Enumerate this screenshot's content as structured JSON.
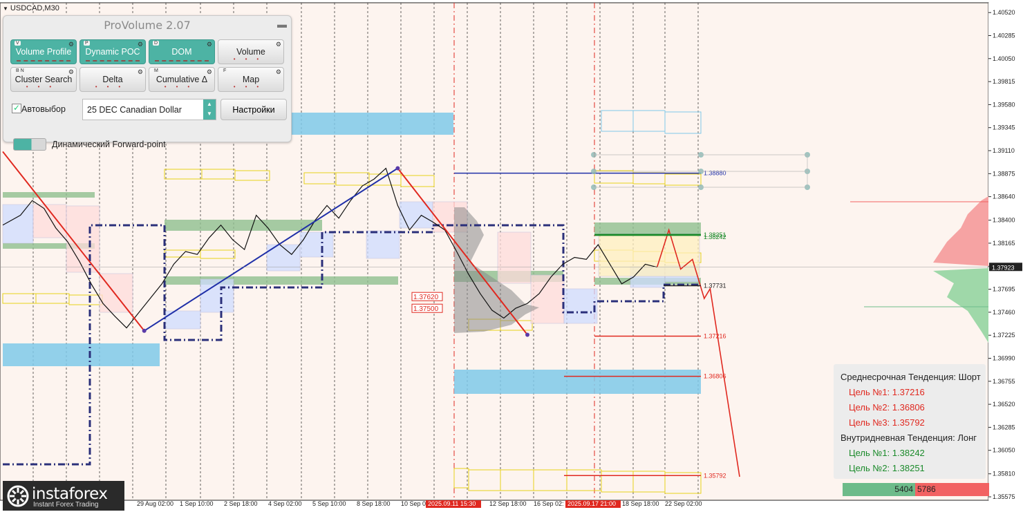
{
  "symbol": "USDCAD,M30",
  "panel": {
    "title": "ProVolume 2.07",
    "buttons": [
      {
        "key": "V",
        "label": "Volume Profile",
        "active": true
      },
      {
        "key": "P",
        "label": "Dynamic POC",
        "active": true
      },
      {
        "key": "D",
        "label": "DOM",
        "active": true
      },
      {
        "key": "",
        "label": "Volume",
        "active": false
      },
      {
        "key": "B N",
        "label": "Cluster Search",
        "active": false
      },
      {
        "key": "",
        "label": "Delta",
        "active": false
      },
      {
        "key": "M",
        "label": "Cumulative Δ",
        "active": false
      },
      {
        "key": "F",
        "label": "Map",
        "active": false
      }
    ],
    "auto_label": "Автовыбор",
    "instrument": "25 DEC Canadian Dollar",
    "settings_label": "Настройки",
    "forward_label": "Динамический Forward-point"
  },
  "trend": {
    "medium_title": "Среднесрочная Тенденция: Шорт",
    "medium_targets": [
      "Цель №1: 1.37216",
      "Цель №2: 1.36806",
      "Цель №3: 1.35792"
    ],
    "intraday_title": "Внутридневная Тенденция: Лонг",
    "intraday_targets": [
      "Цель №1: 1.38242",
      "Цель №2: 1.38251"
    ]
  },
  "volume_bar": {
    "buy": "5404",
    "sell": "5786",
    "buy_color": "#6dbb8a",
    "sell_color": "#f26262"
  },
  "logo": {
    "brand": "instaforex",
    "tagline": "Instant Forex Trading"
  },
  "colors": {
    "bg": "#fdf4ef",
    "up_line": "#1f2fa8",
    "down_line": "#e0281f",
    "grey_zone": "#7fc9e9",
    "hvn": "#8fbf8f"
  },
  "chart_data": {
    "type": "line",
    "title": "USDCAD,M30",
    "y_ticks": [
      "1.40520",
      "1.40285",
      "1.40050",
      "1.39815",
      "1.39580",
      "1.39345",
      "1.39110",
      "1.38875",
      "1.38640",
      "1.38400",
      "1.38165",
      "1.37930",
      "1.37695",
      "1.37460",
      "1.37225",
      "1.36990",
      "1.36755",
      "1.36520",
      "1.36285",
      "1.36050",
      "1.35810",
      "1.35575"
    ],
    "ylim": [
      1.3554,
      1.4062
    ],
    "x_ticks": [
      "29 Aug 02:00",
      "1 Sep 10:00",
      "2 Sep 18:00",
      "4 Sep 02:00",
      "5 Sep 10:00",
      "8 Sep 18:00",
      "10 Sep 0",
      "12 Sep 18:00",
      "16 Sep 02:",
      "18 Sep 18:00",
      "22 Sep 02:00"
    ],
    "x_highlights": [
      "2025.09.11 15:30",
      "2025.09.17 21:00"
    ],
    "current_price": "1.37923",
    "level_labels": [
      {
        "text": "1.38880",
        "price": 1.3888,
        "color": "#1f2fa8"
      },
      {
        "text": "1.38251",
        "price": 1.3825,
        "color": "#1a8a2a"
      },
      {
        "text": "1.38242",
        "price": 1.38242,
        "color": "#1a8a2a"
      },
      {
        "text": "1.37731",
        "price": 1.37731,
        "color": "#222222"
      },
      {
        "text": "1.37216",
        "price": 1.37216,
        "color": "#e0281f"
      },
      {
        "text": "1.36806",
        "price": 1.36806,
        "color": "#e0281f"
      },
      {
        "text": "1.35792",
        "price": 1.35792,
        "color": "#e0281f"
      }
    ],
    "boxed_labels": [
      {
        "text": "1.37620",
        "price": 1.3762
      },
      {
        "text": "1.37500",
        "price": 1.375
      }
    ],
    "price_path": [
      [
        0,
        1.3835
      ],
      [
        6,
        1.3845
      ],
      [
        10,
        1.386
      ],
      [
        14,
        1.3852
      ],
      [
        18,
        1.3832
      ],
      [
        22,
        1.3818
      ],
      [
        26,
        1.3798
      ],
      [
        30,
        1.3775
      ],
      [
        34,
        1.3755
      ],
      [
        38,
        1.3742
      ],
      [
        42,
        1.373
      ],
      [
        46,
        1.3745
      ],
      [
        50,
        1.376
      ],
      [
        54,
        1.3775
      ],
      [
        58,
        1.3795
      ],
      [
        62,
        1.3808
      ],
      [
        66,
        1.3805
      ],
      [
        70,
        1.3822
      ],
      [
        74,
        1.3835
      ],
      [
        78,
        1.382
      ],
      [
        82,
        1.381
      ],
      [
        86,
        1.3845
      ],
      [
        90,
        1.3832
      ],
      [
        94,
        1.3815
      ],
      [
        98,
        1.3805
      ],
      [
        102,
        1.382
      ],
      [
        106,
        1.384
      ],
      [
        110,
        1.3855
      ],
      [
        114,
        1.3842
      ],
      [
        118,
        1.386
      ],
      [
        122,
        1.3875
      ],
      [
        126,
        1.3882
      ],
      [
        130,
        1.3893
      ],
      [
        134,
        1.3855
      ],
      [
        138,
        1.383
      ],
      [
        142,
        1.3845
      ],
      [
        146,
        1.3838
      ],
      [
        150,
        1.383
      ],
      [
        154,
        1.3808
      ],
      [
        158,
        1.3785
      ],
      [
        162,
        1.3765
      ],
      [
        166,
        1.3748
      ],
      [
        170,
        1.374
      ],
      [
        174,
        1.375
      ],
      [
        178,
        1.3755
      ],
      [
        182,
        1.3765
      ],
      [
        186,
        1.3782
      ],
      [
        190,
        1.3795
      ],
      [
        194,
        1.3802
      ],
      [
        198,
        1.38
      ],
      [
        202,
        1.3815
      ],
      [
        206,
        1.3795
      ],
      [
        210,
        1.3775
      ],
      [
        214,
        1.3782
      ],
      [
        218,
        1.3795
      ],
      [
        222,
        1.3792
      ]
    ],
    "forecast_path": [
      [
        222,
        1.3792
      ],
      [
        226,
        1.383
      ],
      [
        230,
        1.379
      ],
      [
        234,
        1.38
      ],
      [
        238,
        1.376
      ],
      [
        240,
        1.377
      ],
      [
        250,
        1.3578
      ]
    ],
    "up_trendline": [
      [
        48,
        1.3727
      ],
      [
        134,
        1.3893
      ]
    ],
    "down_trendlines": [
      [
        [
          0,
          1.391
        ],
        [
          48,
          1.3727
        ]
      ],
      [
        [
          134,
          1.3893
        ],
        [
          178,
          1.3723
        ]
      ]
    ]
  }
}
